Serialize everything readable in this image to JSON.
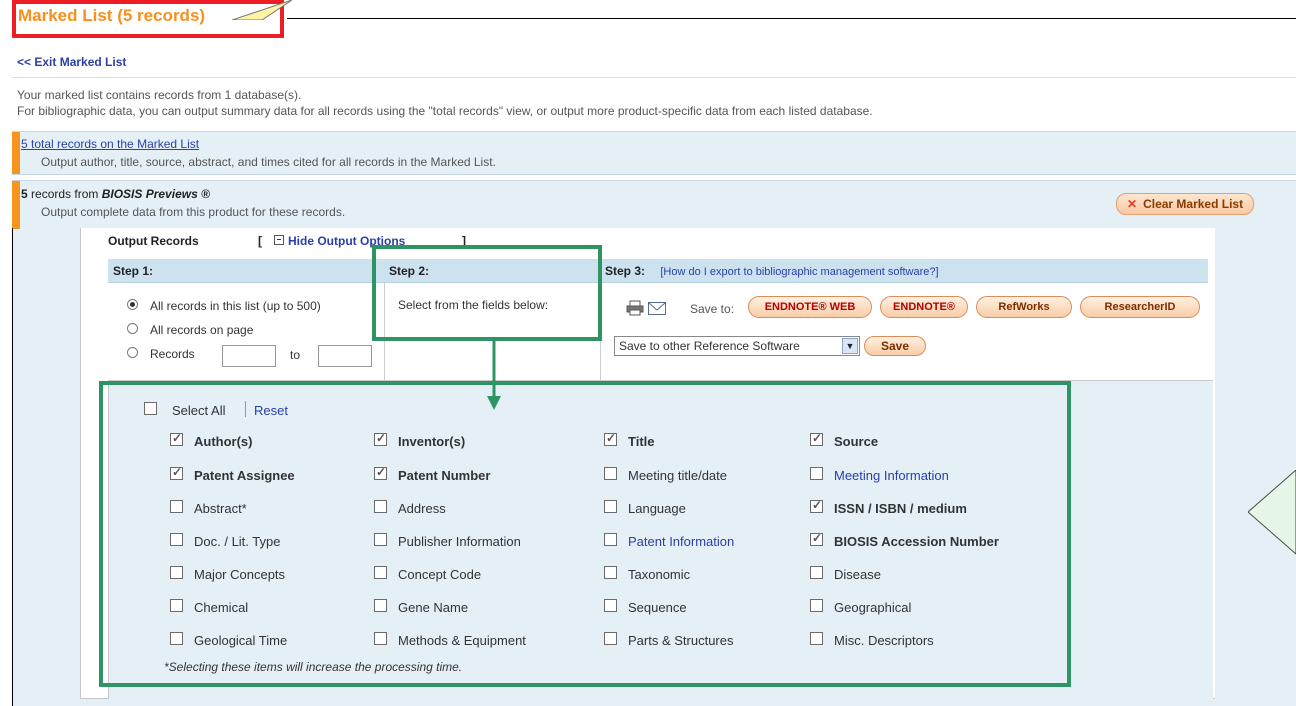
{
  "header": {
    "title": "Marked List (5 records)",
    "exit_link": "<< Exit Marked List"
  },
  "info": {
    "line1": "Your marked list contains records from 1 database(s).",
    "line2": "For bibliographic data, you can output summary data for all records using the \"total records\" view, or output more product-specific data from each listed database."
  },
  "total": {
    "link": "5 total records on the Marked List",
    "desc": "Output author, title, source, abstract, and times cited for all records in the Marked List."
  },
  "product": {
    "count": "5",
    "prefix": " records from ",
    "name": "BIOSIS Previews ®",
    "desc": "Output complete data from this product for these records.",
    "clear_label": "Clear Marked List"
  },
  "output": {
    "label": "Output Records",
    "bracket_open": "[",
    "hide_label": "Hide Output Options",
    "bracket_close": "]"
  },
  "step1": {
    "heading": "Step 1:",
    "opt_all": "All records in this list (up to 500)",
    "opt_page": "All records on page",
    "opt_records": "Records",
    "to": "to"
  },
  "step2": {
    "heading": "Step 2:",
    "text": "Select from the fields below:"
  },
  "step3": {
    "heading": "Step 3:",
    "help_link": "[How do I export to bibliographic management software?]",
    "save_to": "Save to:",
    "buttons": [
      "ENDNOTE® WEB",
      "ENDNOTE®",
      "RefWorks",
      "ResearcherID"
    ],
    "select_value": "Save to other Reference Software",
    "save_button": "Save"
  },
  "fields": {
    "select_all": "Select All",
    "reset": "Reset",
    "items": [
      {
        "label": "Author(s)",
        "checked": true,
        "style": "bold"
      },
      {
        "label": "Inventor(s)",
        "checked": true,
        "style": "bold"
      },
      {
        "label": "Title",
        "checked": true,
        "style": "bold"
      },
      {
        "label": "Source",
        "checked": true,
        "style": "bold"
      },
      {
        "label": "Patent Assignee",
        "checked": true,
        "style": "bold"
      },
      {
        "label": "Patent Number",
        "checked": true,
        "style": "bold"
      },
      {
        "label": "Meeting title/date",
        "checked": false,
        "style": "normal"
      },
      {
        "label": "Meeting Information",
        "checked": false,
        "style": "link"
      },
      {
        "label": "Abstract*",
        "checked": false,
        "style": "normal"
      },
      {
        "label": "Address",
        "checked": false,
        "style": "normal"
      },
      {
        "label": "Language",
        "checked": false,
        "style": "normal"
      },
      {
        "label": "ISSN / ISBN / medium",
        "checked": true,
        "style": "bold"
      },
      {
        "label": "Doc. / Lit. Type",
        "checked": false,
        "style": "normal"
      },
      {
        "label": "Publisher Information",
        "checked": false,
        "style": "normal"
      },
      {
        "label": "Patent Information",
        "checked": false,
        "style": "link"
      },
      {
        "label": "BIOSIS Accession Number",
        "checked": true,
        "style": "bold"
      },
      {
        "label": "Major Concepts",
        "checked": false,
        "style": "normal"
      },
      {
        "label": "Concept Code",
        "checked": false,
        "style": "normal"
      },
      {
        "label": "Taxonomic",
        "checked": false,
        "style": "normal"
      },
      {
        "label": "Disease",
        "checked": false,
        "style": "normal"
      },
      {
        "label": "Chemical",
        "checked": false,
        "style": "normal"
      },
      {
        "label": "Gene Name",
        "checked": false,
        "style": "normal"
      },
      {
        "label": "Sequence",
        "checked": false,
        "style": "normal"
      },
      {
        "label": "Geographical",
        "checked": false,
        "style": "normal"
      },
      {
        "label": "Geological Time",
        "checked": false,
        "style": "normal"
      },
      {
        "label": "Methods & Equipment",
        "checked": false,
        "style": "normal"
      },
      {
        "label": "Parts & Structures",
        "checked": false,
        "style": "normal"
      },
      {
        "label": "Misc. Descriptors",
        "checked": false,
        "style": "normal"
      }
    ],
    "note": "*Selecting these items will increase the processing time."
  },
  "colors": {
    "title_orange": "#f7901e",
    "highlight_red": "#ee1c25",
    "annotation_green": "#2e9463",
    "link_blue": "#2a3fa8",
    "panel_blue": "#e4f0f6"
  }
}
